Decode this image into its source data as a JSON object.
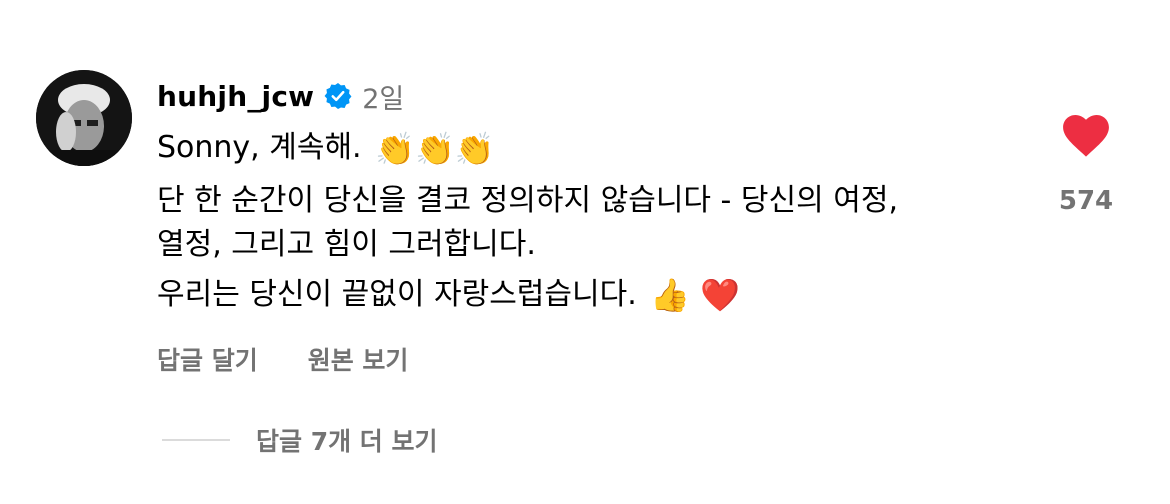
{
  "comment": {
    "username": "huhjh_jcw",
    "verified_icon": "verified-badge-icon",
    "timestamp": "2일",
    "lines": [
      {
        "text": "Sonny, 계속해.",
        "emoji": "👏👏👏"
      },
      {
        "text": "단 한 순간이 당신을 결코 정의하지 않습니다 - 당신의 여정,",
        "emoji": ""
      },
      {
        "text": "열정, 그리고 힘이 그러합니다.",
        "emoji": ""
      },
      {
        "text": "우리는 당신이 끝없이 자랑스럽습니다.",
        "emoji": "👍 ❤️"
      }
    ],
    "actions": {
      "reply": "답글 달기",
      "see_original": "원본 보기"
    }
  },
  "like": {
    "icon": "heart-icon",
    "count": "574",
    "color": "#ed2e42"
  },
  "replies": {
    "label": "답글 7개 더 보기"
  },
  "colors": {
    "secondary_text": "#737373",
    "verified": "#0095f6",
    "divider": "#dbdbdb"
  }
}
